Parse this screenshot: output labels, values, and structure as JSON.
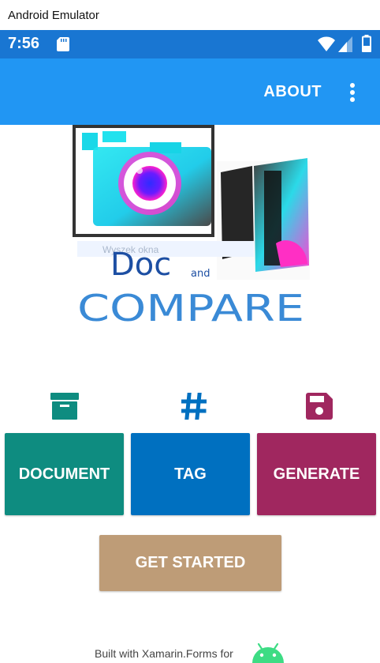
{
  "window": {
    "title": "Android Emulator"
  },
  "statusbar": {
    "time": "7:56",
    "icons": [
      "sd-card-icon",
      "wifi-icon",
      "signal-icon",
      "battery-icon"
    ]
  },
  "appbar": {
    "about_label": "ABOUT",
    "menu_icon": "more-vert-icon",
    "color": "#2196F3"
  },
  "logo": {
    "line1": "Doc",
    "and": "and",
    "line2": "COMPARE",
    "watermark": "Wyszek okna"
  },
  "features": [
    {
      "icon": "archive-icon",
      "label": "DOCUMENT",
      "color": "#0E8C80"
    },
    {
      "icon": "hash-icon",
      "label": "TAG",
      "color": "#0070C0"
    },
    {
      "icon": "save-icon",
      "label": "GENERATE",
      "color": "#A0275F"
    }
  ],
  "get_started_label": "GET STARTED",
  "footer": {
    "text": "Built with Xamarin.Forms for",
    "icon": "android-icon"
  }
}
